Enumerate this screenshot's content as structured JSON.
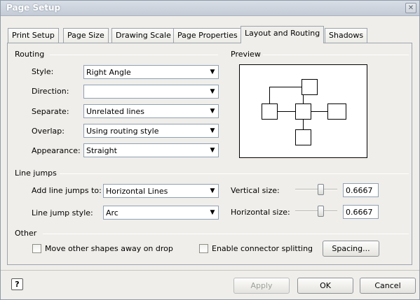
{
  "window": {
    "title": "Page Setup"
  },
  "tabs": [
    {
      "label": "Print Setup"
    },
    {
      "label": "Page Size"
    },
    {
      "label": "Drawing Scale"
    },
    {
      "label": "Page Properties"
    },
    {
      "label": "Layout and Routing"
    },
    {
      "label": "Shadows"
    }
  ],
  "active_tab": "Layout and Routing",
  "routing": {
    "group_label": "Routing",
    "style": {
      "label": "Style:",
      "value": "Right Angle"
    },
    "direction": {
      "label": "Direction:",
      "value": ""
    },
    "separate": {
      "label": "Separate:",
      "value": "Unrelated lines"
    },
    "overlap": {
      "label": "Overlap:",
      "value": "Using routing style"
    },
    "appearance": {
      "label": "Appearance:",
      "value": "Straight"
    }
  },
  "preview": {
    "group_label": "Preview"
  },
  "line_jumps": {
    "group_label": "Line jumps",
    "add_to": {
      "label": "Add line jumps to:",
      "value": "Horizontal Lines"
    },
    "style": {
      "label": "Line jump style:",
      "value": "Arc"
    },
    "vertical_size": {
      "label": "Vertical size:",
      "value": "0.6667",
      "level": 0.6667
    },
    "horizontal_size": {
      "label": "Horizontal size:",
      "value": "0.6667",
      "level": 0.6667
    }
  },
  "other": {
    "group_label": "Other",
    "move_shapes": {
      "label": "Move other shapes away on drop",
      "checked": false
    },
    "connector_splitting": {
      "label": "Enable connector splitting",
      "checked": false
    },
    "spacing_button": "Spacing..."
  },
  "footer": {
    "help_glyph": "?",
    "apply": "Apply",
    "ok": "OK",
    "cancel": "Cancel"
  }
}
